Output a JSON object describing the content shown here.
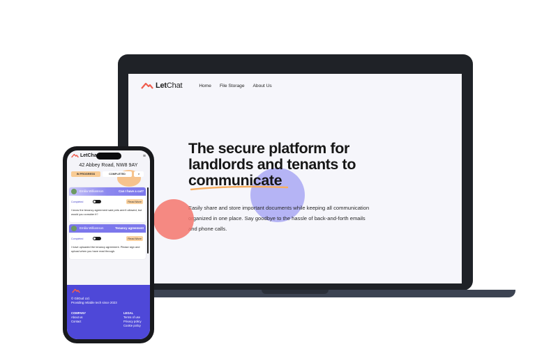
{
  "desktop": {
    "logo_text_bold": "Let",
    "logo_text_regular": "Chat",
    "nav": [
      "Home",
      "File Storage",
      "About Us"
    ],
    "hero_title_line1": "The secure platform for",
    "hero_title_line2": "landlords and tenants to",
    "hero_title_line3": "communicate",
    "hero_body_line1": "Easily share and store important documents while keeping all communication",
    "hero_body_line2": "organized in one place. Say goodbye to the hassle of back-and-forth emails",
    "hero_body_line3": "and phone calls."
  },
  "mobile": {
    "logo_text": "LetCha",
    "menu_icon": "hamburger-icon",
    "address": "42 Abbey Road, NW8 9AY",
    "tabs": [
      "IN PROGRESS",
      "COMPLETED",
      ">"
    ],
    "cards": [
      {
        "name": "Emilia Williamson",
        "topic": "Can I have a cat?",
        "status": "Completed",
        "action": "Read More",
        "message": "I know the tenancy agreement said pets aren't allowed, but would you consider it?"
      },
      {
        "name": "Emilia Williamson",
        "topic": "Tenancy agreement",
        "status": "Completed",
        "action": "Read More",
        "message": "I have uploaded the tenancy agreement. Please sign and upload when you have read through."
      }
    ],
    "footer": {
      "copyright": "© GitGud Ltd.",
      "tagline": "Providing reliable tech since 2023",
      "company_heading": "COMPANY",
      "company_links": [
        "About us",
        "Contact"
      ],
      "legal_heading": "LEGAL",
      "legal_links": [
        "Terms of use",
        "Privacy policy",
        "Cookie policy"
      ]
    }
  },
  "colors": {
    "accent_red": "#f05d4e",
    "accent_purple": "#4e48d8",
    "accent_orange": "#f7ae60"
  }
}
